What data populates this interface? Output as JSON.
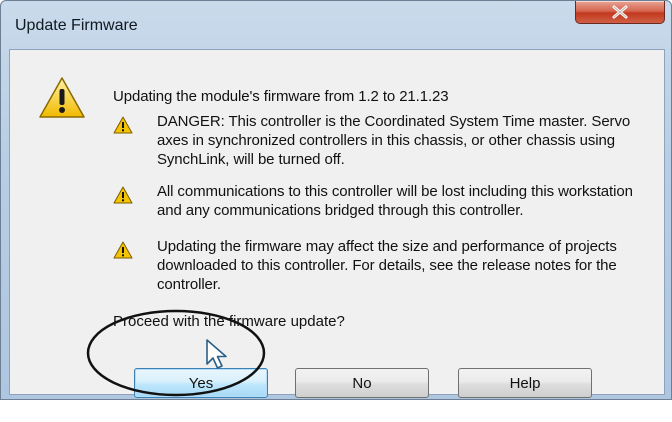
{
  "window": {
    "title": "Update Firmware"
  },
  "dialog": {
    "headline": "Updating the module's firmware from 1.2 to 21.1.23",
    "warnings": [
      "DANGER: This controller is the Coordinated System Time master. Servo axes in synchronized controllers in this chassis, or other chassis using SynchLink, will be turned off.",
      "All communications to this controller will be lost including this workstation and any communications bridged through this controller.",
      "Updating the firmware may affect the size and performance of projects downloaded to this controller.  For details, see the release notes for the controller."
    ],
    "prompt": "Proceed with the firmware update?"
  },
  "buttons": {
    "yes": "Yes",
    "no": "No",
    "help": "Help"
  },
  "icons": {
    "main": "warning-icon",
    "item": "warning-icon",
    "close": "close-icon"
  },
  "colors": {
    "warning_yellow": "#f5c400",
    "default_button_border": "#3c7fb1",
    "close_button": "#c9452d"
  }
}
